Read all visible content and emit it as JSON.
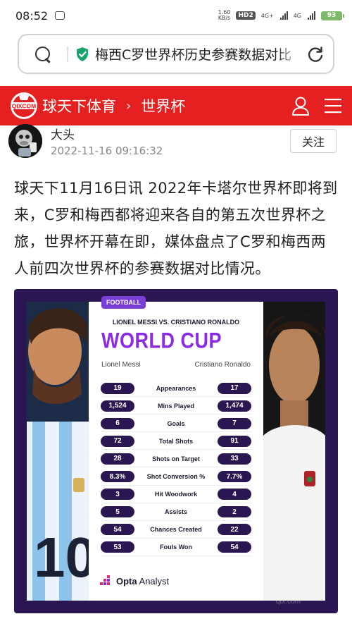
{
  "status_bar": {
    "time": "08:52",
    "net_speed_value": "1.60",
    "net_speed_unit": "KB/s",
    "hd_badge": "HD2",
    "network_1": "4G+",
    "network_2": "4G",
    "battery": "93"
  },
  "address_bar": {
    "query": "梅西C罗世界杯历史参赛数据对比"
  },
  "site_header": {
    "site_name": "球天下体育",
    "separator": "›",
    "section": "世界杯",
    "brand_color": "#e52020"
  },
  "author": {
    "name": "大头",
    "timestamp": "2022-11-16 09:16:32",
    "follow_label": "关注"
  },
  "article": {
    "paragraph": "球天下11月16日讯 2022年卡塔尔世界杯即将到来，C罗和梅西都将迎来各自的第五次世界杯之旅，世界杯开幕在即，媒体盘点了C罗和梅西两人前四次世界杯的参赛数据对比情况。"
  },
  "infographic": {
    "tag": "FOOTBALL",
    "matchup": "LIONEL MESSI VS. CRISTIANO RONALDO",
    "title": "WORLD CUP",
    "left_player": "Lionel Messi",
    "right_player": "Cristiano Ronaldo",
    "stats": [
      {
        "label": "Appearances",
        "left": "19",
        "right": "17"
      },
      {
        "label": "Mins Played",
        "left": "1,524",
        "right": "1,474"
      },
      {
        "label": "Goals",
        "left": "6",
        "right": "7"
      },
      {
        "label": "Total Shots",
        "left": "72",
        "right": "91"
      },
      {
        "label": "Shots on Target",
        "left": "28",
        "right": "33"
      },
      {
        "label": "Shot Conversion %",
        "left": "8.3%",
        "right": "7.7%"
      },
      {
        "label": "Hit Woodwork",
        "left": "3",
        "right": "4"
      },
      {
        "label": "Assists",
        "left": "5",
        "right": "2"
      },
      {
        "label": "Chances Created",
        "left": "54",
        "right": "22"
      },
      {
        "label": "Fouls Won",
        "left": "53",
        "right": "54"
      }
    ],
    "source_brand": "Opta",
    "source_suffix": "Analyst",
    "watermark": "qtx.com",
    "accent_color": "#8b2be2",
    "dark_color": "#2a1650"
  }
}
